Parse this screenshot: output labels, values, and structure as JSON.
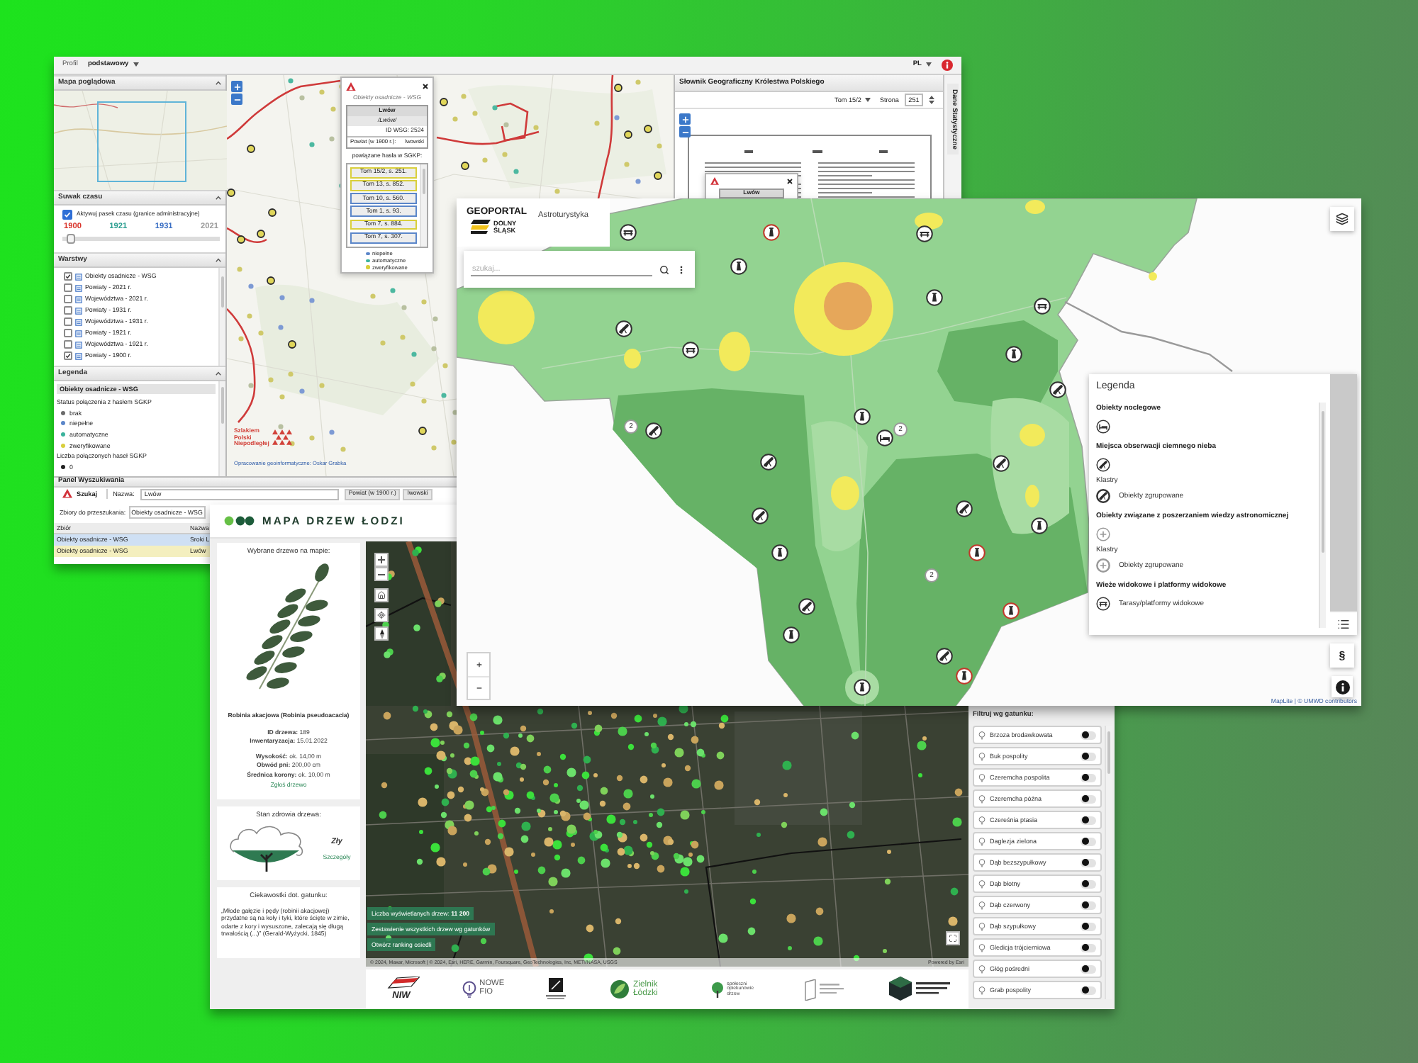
{
  "wsg_window": {
    "top_bar": {
      "profile_label": "Profil",
      "profile_value": "podstawowy",
      "language": "PL"
    },
    "overview": {
      "title": "Mapa poglądowa"
    },
    "time_slider": {
      "title": "Suwak czasu",
      "label": "Aktywuj pasek czasu (granice administracyjne)",
      "checked": true,
      "years": [
        {
          "label": "1900",
          "color": "#d9342b"
        },
        {
          "label": "1921",
          "color": "#2a9d8f"
        },
        {
          "label": "1931",
          "color": "#3a6fc4"
        },
        {
          "label": "2021",
          "color": "#9a9a9a"
        }
      ],
      "level": 0.03
    },
    "layers": {
      "title": "Warstwy",
      "items": [
        {
          "label": "Obiekty osadnicze - WSG",
          "checked": true
        },
        {
          "label": "Powiaty - 2021 r.",
          "checked": false
        },
        {
          "label": "Województwa - 2021 r.",
          "checked": false
        },
        {
          "label": "Powiaty - 1931 r.",
          "checked": false
        },
        {
          "label": "Województwa - 1931 r.",
          "checked": false
        },
        {
          "label": "Powiaty - 1921 r.",
          "checked": false
        },
        {
          "label": "Województwa - 1921 r.",
          "checked": false
        },
        {
          "label": "Powiaty - 1900 r.",
          "checked": true
        }
      ]
    },
    "legend": {
      "title": "Legenda",
      "group": "Obiekty osadnicze - WSG",
      "status_title": "Status połączenia z hasłem SGKP",
      "statuses": [
        {
          "label": "brak",
          "color": "#6b6b6b"
        },
        {
          "label": "niepełne",
          "color": "#5b86c9"
        },
        {
          "label": "automatyczne",
          "color": "#3bb39c"
        },
        {
          "label": "zweryfikowane",
          "color": "#d9cf3c"
        }
      ],
      "count_title": "Liczba połączonych haseł SGKP",
      "counts": [
        {
          "label": "0",
          "color": "#222222"
        }
      ]
    },
    "map": {
      "brand": "Szlakiem Polski Niepodległej",
      "credit": "Opracowanie geoinformatyczne: Oskar Grabka"
    },
    "popup": {
      "subtitle": "Obiekty osadnicze - WSG",
      "name": "Lwów",
      "alt_name": "/Lwów/",
      "id": "ID WSG: 2524",
      "district_label": "Powiat (w 1900 r.):",
      "district_value": "lwowski",
      "links_title": "powiązane hasła w SGKP:",
      "links": [
        {
          "label": "Tom 15/2, s. 251.",
          "color": "#d9cf3c"
        },
        {
          "label": "Tom 13, s. 852.",
          "color": "#d9cf3c"
        },
        {
          "label": "Tom 10, s. 560.",
          "color": "#5b86c9"
        },
        {
          "label": "Tom 1, s. 93.",
          "color": "#5b86c9"
        },
        {
          "label": "Tom 7, s. 884.",
          "color": "#d9cf3c"
        },
        {
          "label": "Tom 7, s. 307.",
          "color": "#5b86c9"
        }
      ],
      "legend": [
        {
          "label": "niepełne",
          "color": "#5b86c9"
        },
        {
          "label": "automatyczne",
          "color": "#3bb39c"
        },
        {
          "label": "zweryfikowane",
          "color": "#d9cf3c"
        }
      ]
    },
    "mini_popup": {
      "name": "Lwów"
    },
    "dictionary": {
      "title": "Słownik Geograficzny Królestwa Polskiego",
      "volume": "Tom 15/2",
      "page_label": "Strona",
      "page": "251"
    },
    "side_tab": "Dane Statystyczne",
    "search": {
      "title": "Panel Wyszukiwania",
      "button": "Szukaj",
      "name_label": "Nazwa:",
      "name_value": "Lwów",
      "result_headers": [
        "Powiat (w 1900 r.)",
        "lwowski"
      ],
      "sets_label": "Zbiory do przeszukania:",
      "sets_value": "Obiekty osadnicze - WSG",
      "columns": [
        "Zbiór",
        "Nazwa"
      ],
      "rows": [
        {
          "cells": [
            "Obiekty osadnicze - WSG",
            "Sroki L"
          ],
          "color": "#cfe0f4"
        },
        {
          "cells": [
            "Obiekty osadnicze - WSG",
            "Lwów"
          ],
          "color": "#f4efbf"
        }
      ]
    }
  },
  "tree_window": {
    "title": "MAPA DRZEW ŁODZI",
    "selected_tree": {
      "title": "Wybrane drzewo na mapie:",
      "species": "Robinia akacjowa (Robinia pseudoacacia)",
      "ids": [
        "**ID drzewa:** 189",
        "**Inwentaryzacja:** 15.01.2022"
      ],
      "measures": [
        "**Wysokość:** ok. 14,00 m",
        "**Obwód pni:** 200,00 cm",
        "**Średnica korony:** ok. 10,00 m"
      ],
      "report_link": "Zgłoś drzewo"
    },
    "health": {
      "title": "Stan zdrowia drzewa:",
      "status": "Zły",
      "details_link": "Szczegóły"
    },
    "facts": {
      "title": "Ciekawostki dot. gatunku:",
      "text": "„Młode gałęzie i pędy (robinii akacjowej) przydatne są na koły i tyki, które ścięte w zimie, odarte z kory i wysuszone, zalecają się długą trwałością (...)” (Gerald-Wyżycki, 1845)"
    },
    "map": {
      "count": "Liczba wyświetlanych drzew: **11 200**",
      "summary_button": "Zestawienie wszystkich drzew wg gatunków",
      "ranking_button": "Otwórz ranking osiedli",
      "attribution": "© 2024, Maxar, Microsoft | © 2024, Esri, HERE, Garmin, Foursquare, GeoTechnologies, Inc, METI/NASA, USGS",
      "powered_by": "Powered by Esri"
    },
    "filter": {
      "title": "Filtruj wg gatunku:",
      "species": [
        {
          "label": "Brzoza brodawkowata",
          "on": false
        },
        {
          "label": "Buk pospolity",
          "on": false
        },
        {
          "label": "Czeremcha pospolita",
          "on": false
        },
        {
          "label": "Czeremcha późna",
          "on": false
        },
        {
          "label": "Czereśnia ptasia",
          "on": false
        },
        {
          "label": "Daglezja zielona",
          "on": false
        },
        {
          "label": "Dąb bezszypułkowy",
          "on": false
        },
        {
          "label": "Dąb błotny",
          "on": false
        },
        {
          "label": "Dąb czerwony",
          "on": false
        },
        {
          "label": "Dąb szypułkowy",
          "on": false
        },
        {
          "label": "Gledicja trójcierniowa",
          "on": false
        },
        {
          "label": "Głóg pośredni",
          "on": false
        },
        {
          "label": "Grab pospolity",
          "on": false
        }
      ]
    },
    "partners": [
      {
        "kind": "niw",
        "label": "NIW"
      },
      {
        "kind": "fio",
        "label": "NOWE FIO"
      },
      {
        "kind": "square"
      },
      {
        "kind": "zielnik",
        "label": "Zielnik Łódzki"
      },
      {
        "kind": "guardians",
        "label": "społeczni opiekunowie drzew"
      },
      {
        "kind": "book"
      },
      {
        "kind": "cube"
      }
    ]
  },
  "geoportal_window": {
    "logo": {
      "name": "GEOPORTAL",
      "region": [
        "DOLNY",
        "ŚLĄSK"
      ]
    },
    "app_title": "Astroturystyka",
    "search": {
      "placeholder": "szukaj..."
    },
    "legend": {
      "title": "Legenda",
      "groups": [
        {
          "title": "Obiekty noclegowe",
          "kind": "lodging",
          "entries": [
            {
              "kind": "marker"
            }
          ]
        },
        {
          "title": "Miejsca obserwacji ciemnego nieba",
          "kind": "darksky",
          "entries": [
            {
              "kind": "marker"
            },
            {
              "kind": "subheading",
              "label": "Klastry"
            },
            {
              "kind": "cluster",
              "label": "Obiekty zgrupowane"
            }
          ]
        },
        {
          "title": "Obiekty związane z poszerzaniem wiedzy astronomicznej",
          "kind": "education",
          "entries": [
            {
              "kind": "marker"
            },
            {
              "kind": "subheading",
              "label": "Klastry"
            },
            {
              "kind": "cluster",
              "label": "Obiekty zgrupowane"
            }
          ]
        },
        {
          "title": "Wieże widokowe i platformy widokowe",
          "kind": "tower",
          "entries": [
            {
              "kind": "marker",
              "label": "Tarasy/platformy widokowe"
            }
          ]
        }
      ]
    },
    "section_button": "§",
    "clusters": [
      {
        "count": "2"
      },
      {
        "count": "2"
      },
      {
        "count": "2"
      }
    ],
    "attribution": "MapLite | © UMWD contributors"
  }
}
